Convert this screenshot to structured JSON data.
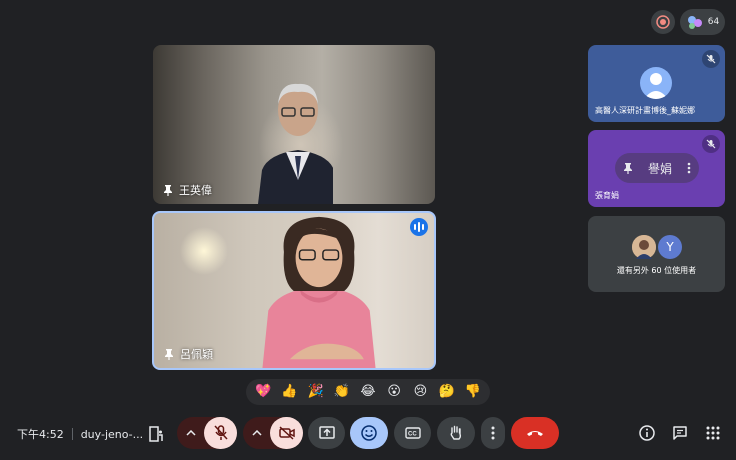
{
  "top": {
    "participant_count": "64"
  },
  "main_tiles": [
    {
      "name": "王英偉"
    },
    {
      "name": "呂佩穎"
    }
  ],
  "side_tiles": [
    {
      "name": "高醫人深研計畫博後_蘇妮娜"
    },
    {
      "name": "張育娟",
      "hover_label": "譽娟"
    },
    {
      "avatar_letter": "Y",
      "others_text": "還有另外 60 位使用者"
    }
  ],
  "reactions": [
    "💖",
    "👍",
    "🎉",
    "👏",
    "😂",
    "😮",
    "😢",
    "🤔",
    "👎"
  ],
  "bottom": {
    "time": "下午4:52",
    "meeting_code": "duy-jeno-..."
  },
  "colors": {
    "background": "#202124",
    "control": "#3c4043",
    "muted_red": "#f9dedc",
    "end_call": "#d93025",
    "active_blue": "#a8c7fa"
  }
}
